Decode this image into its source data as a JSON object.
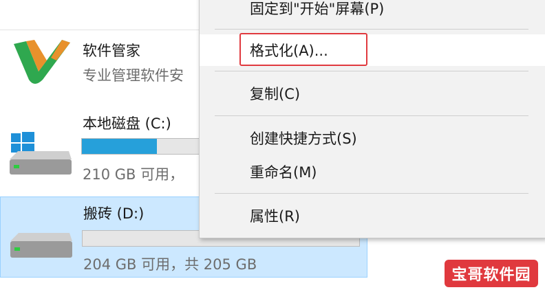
{
  "explorer": {
    "app_entry": {
      "name": "软件管家",
      "subtitle": "专业管理软件安",
      "icon": "software-manager-icon"
    },
    "drives": [
      {
        "name": "本地磁盘 (C:)",
        "usage": "210 GB 可用，",
        "used_fraction": 0.27,
        "icon": "windows-drive-icon",
        "selected": false
      },
      {
        "name": "搬砖 (D:)",
        "usage": "204 GB 可用，共 205 GB",
        "used_fraction": 0.0,
        "icon": "hard-drive-icon",
        "selected": true
      }
    ]
  },
  "context_menu": {
    "items": [
      {
        "label": "固定到\"开始\"屏幕(P)"
      },
      {
        "label": "格式化(A)...",
        "highlighted": true
      },
      {
        "label": "复制(C)"
      },
      {
        "label": "创建快捷方式(S)"
      },
      {
        "label": "重命名(M)"
      },
      {
        "label": "属性(R)"
      }
    ]
  },
  "watermark": {
    "text": "宝哥软件园"
  },
  "colors": {
    "accent": "#26a0da",
    "selection_bg": "#cce8ff",
    "highlight_box": "#e0393e"
  }
}
